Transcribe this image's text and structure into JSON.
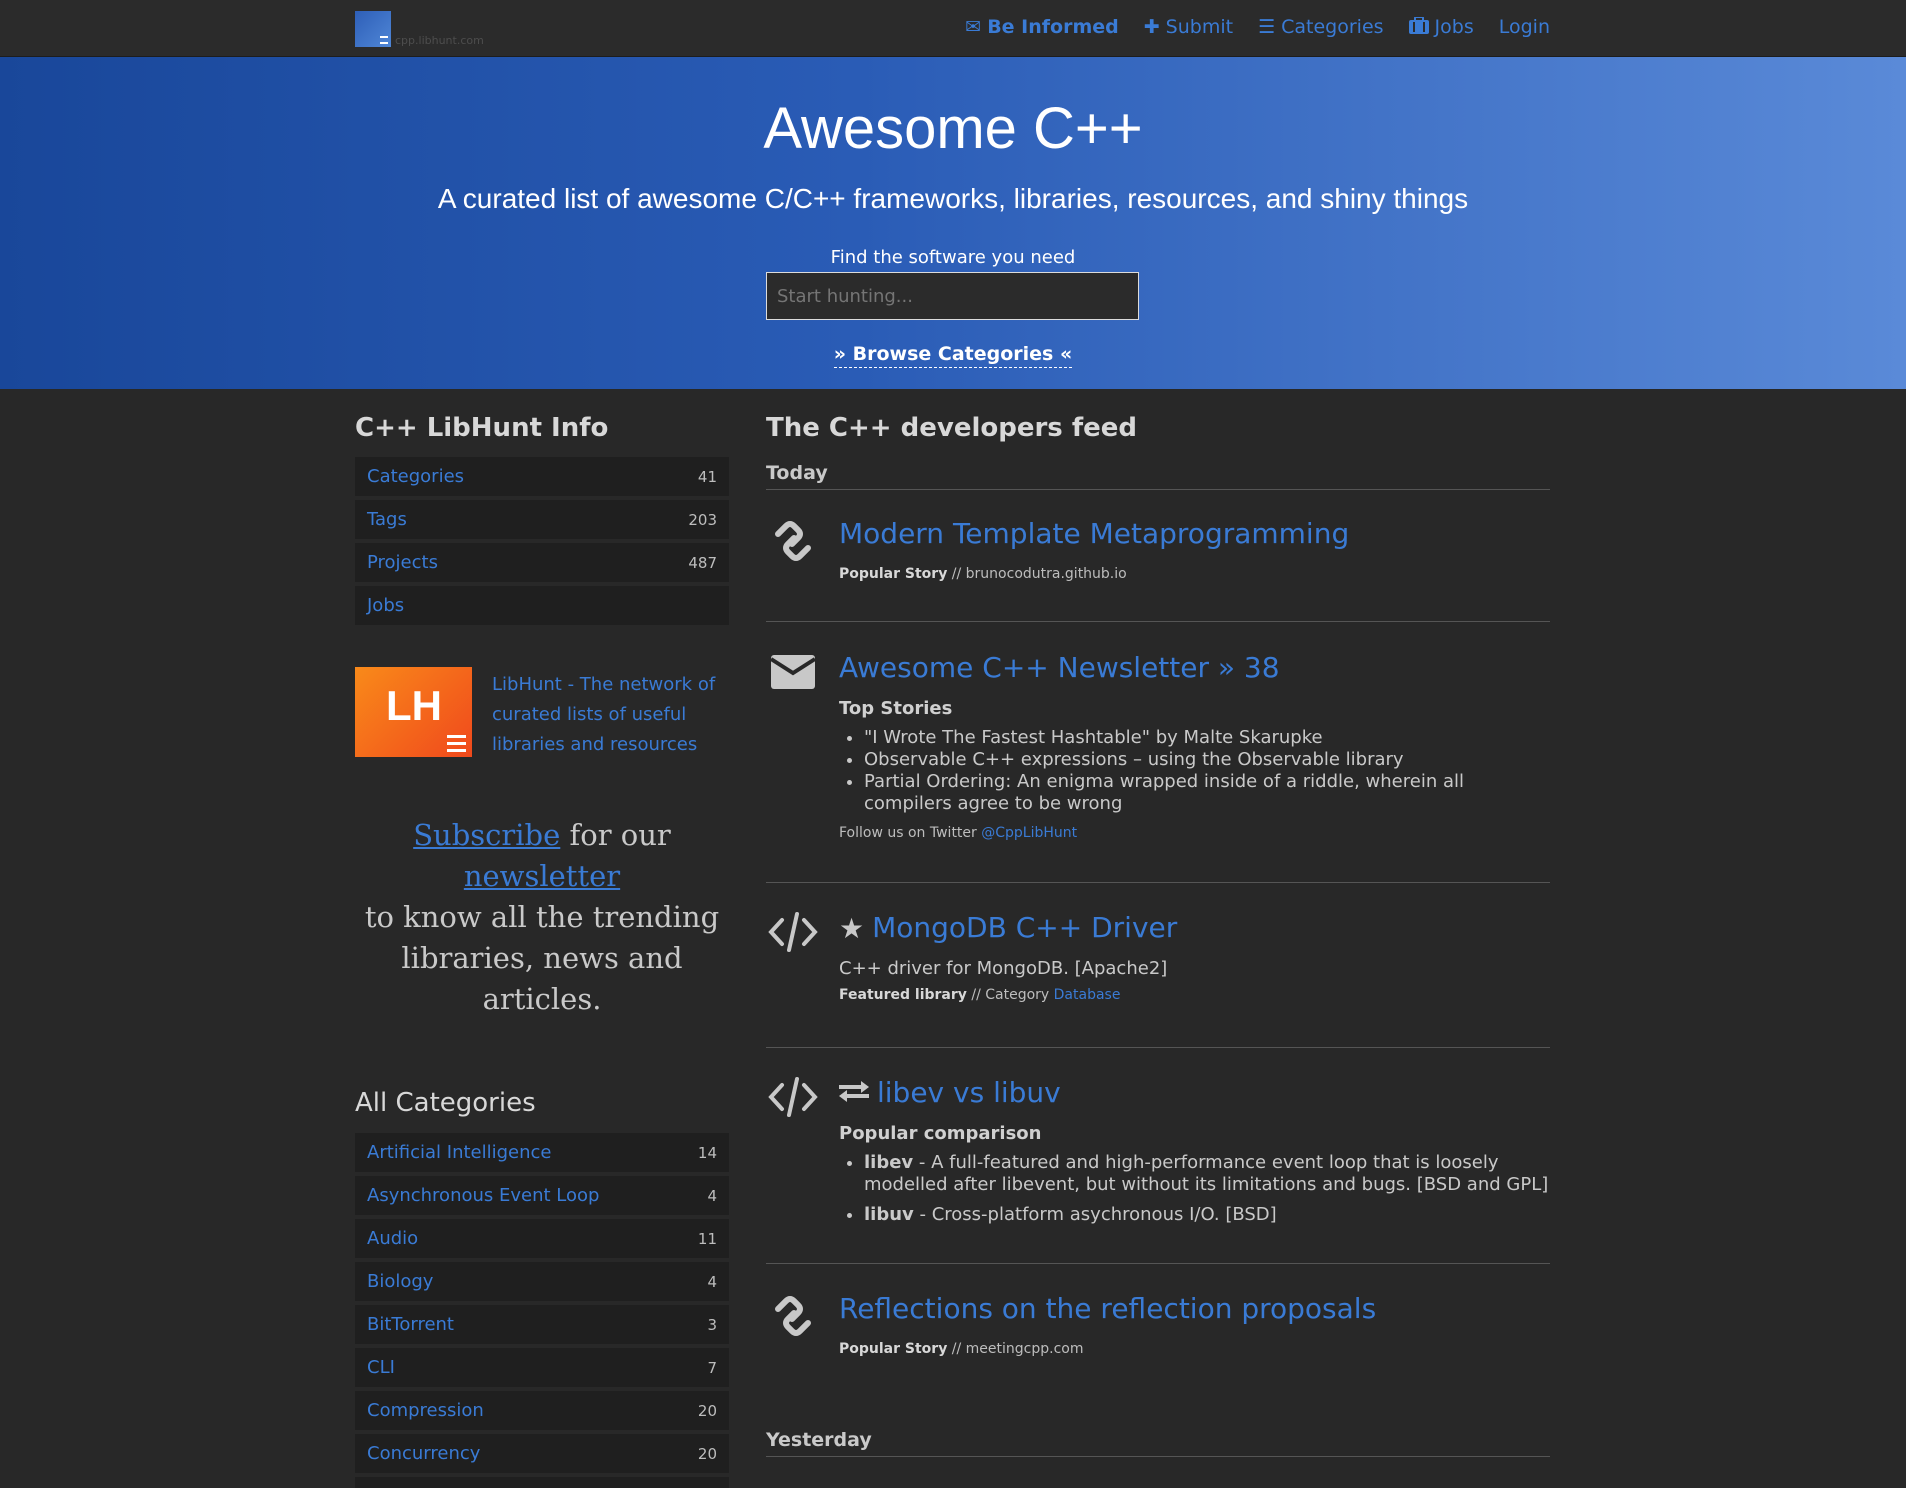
{
  "nav": {
    "brand_text": "cpp.libhunt.com",
    "links": [
      {
        "label": "Be Informed",
        "icon": "envelope-icon"
      },
      {
        "label": "Submit",
        "icon": "plus-icon"
      },
      {
        "label": "Categories",
        "icon": "list-icon"
      },
      {
        "label": "Jobs",
        "icon": "briefcase-icon"
      },
      {
        "label": "Login",
        "icon": ""
      }
    ]
  },
  "hero": {
    "title": "Awesome C++",
    "subtitle": "A curated list of awesome C/C++ frameworks, libraries, resources, and shiny things",
    "search_label": "Find the software you need",
    "search_placeholder": "Start hunting...",
    "browse": "» Browse Categories «"
  },
  "info": {
    "heading": "C++ LibHunt Info",
    "rows": [
      {
        "label": "Categories",
        "count": "41"
      },
      {
        "label": "Tags",
        "count": "203"
      },
      {
        "label": "Projects",
        "count": "487"
      },
      {
        "label": "Jobs",
        "count": ""
      }
    ]
  },
  "libhunt": {
    "logo_text": "LH",
    "description": "LibHunt - The network of curated lists of useful libraries and resources"
  },
  "subscribe": {
    "link1": "Subscribe",
    "text1": "for our",
    "link2": "newsletter",
    "text2": "to know all the trending libraries, news and articles."
  },
  "categories": {
    "heading": "All Categories",
    "rows": [
      {
        "label": "Artificial Intelligence",
        "count": "14"
      },
      {
        "label": "Asynchronous Event Loop",
        "count": "4"
      },
      {
        "label": "Audio",
        "count": "11"
      },
      {
        "label": "Biology",
        "count": "4"
      },
      {
        "label": "BitTorrent",
        "count": "3"
      },
      {
        "label": "CLI",
        "count": "7"
      },
      {
        "label": "Compression",
        "count": "20"
      },
      {
        "label": "Concurrency",
        "count": "20"
      }
    ]
  },
  "feed": {
    "heading": "The C++ developers feed",
    "today": "Today",
    "yesterday": "Yesterday",
    "items": [
      {
        "icon": "link-icon",
        "title": "Modern Template Metaprogramming",
        "meta_bold": "Popular Story",
        "meta_rest": " // brunocodutra.github.io"
      },
      {
        "icon": "envelope-icon",
        "title": "Awesome C++ Newsletter » 38",
        "sub": "Top Stories",
        "bullets": [
          "\"I Wrote The Fastest Hashtable\" by Malte Skarupke",
          "Observable C++ expressions – using the Observable library",
          "Partial Ordering: An enigma wrapped inside of a riddle, wherein all compilers agree to be wrong"
        ],
        "follow_text": "Follow us on Twitter ",
        "follow_link": "@CppLibHunt"
      },
      {
        "icon": "code-icon",
        "title": "MongoDB C++ Driver",
        "desc": "C++ driver for MongoDB. [Apache2]",
        "meta_bold": "Featured library",
        "meta_rest": " // Category ",
        "meta_link": "Database"
      },
      {
        "icon": "code-icon",
        "title": "libev vs libuv",
        "sub": "Popular comparison",
        "compare": [
          {
            "name": "libev",
            "text": " - A full-featured and high-performance event loop that is loosely modelled after libevent, but without its limitations and bugs. [BSD and GPL]"
          },
          {
            "name": "libuv",
            "text": " - Cross-platform asychronous I/O. [BSD]"
          }
        ]
      },
      {
        "icon": "link-icon",
        "title": "Reflections on the reflection proposals",
        "meta_bold": "Popular Story",
        "meta_rest": " // meetingcpp.com"
      }
    ]
  },
  "colors": {
    "link": "#3a7bd5",
    "background": "#282828",
    "hero_start": "#19479a",
    "hero_end": "#5a8ad8",
    "libhunt_orange": "#f0491c"
  }
}
